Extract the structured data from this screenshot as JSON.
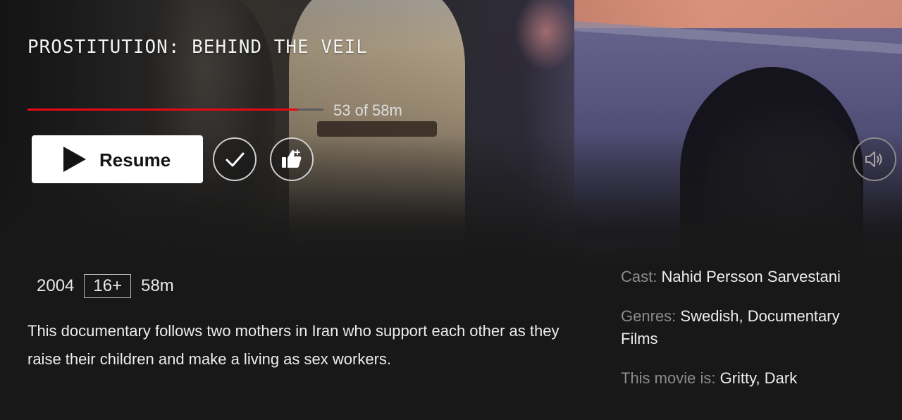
{
  "title": "PROSTITUTION: BEHIND THE VEIL",
  "progress": {
    "text": "53 of 58m",
    "watched_minutes": 53,
    "total_minutes": 58
  },
  "buttons": {
    "resume_label": "Resume"
  },
  "meta": {
    "year": "2004",
    "rating": "16+",
    "duration": "58m"
  },
  "synopsis": "This documentary follows two mothers in Iran who support each other as they raise their children and make a living as sex workers.",
  "info": {
    "cast_label": "Cast:",
    "cast_value": "Nahid Persson Sarvestani",
    "genres_label": "Genres:",
    "genres_value": "Swedish, Documentary Films",
    "moods_label": "This movie is:",
    "moods_value": "Gritty, Dark"
  },
  "colors": {
    "progress_fill": "#e50914",
    "background": "#181818",
    "button_bg": "#ffffff"
  },
  "icons": {
    "play": "play-icon",
    "add_to_list": "check-icon",
    "rate": "thumbs-up-icon",
    "audio": "speaker-icon"
  }
}
